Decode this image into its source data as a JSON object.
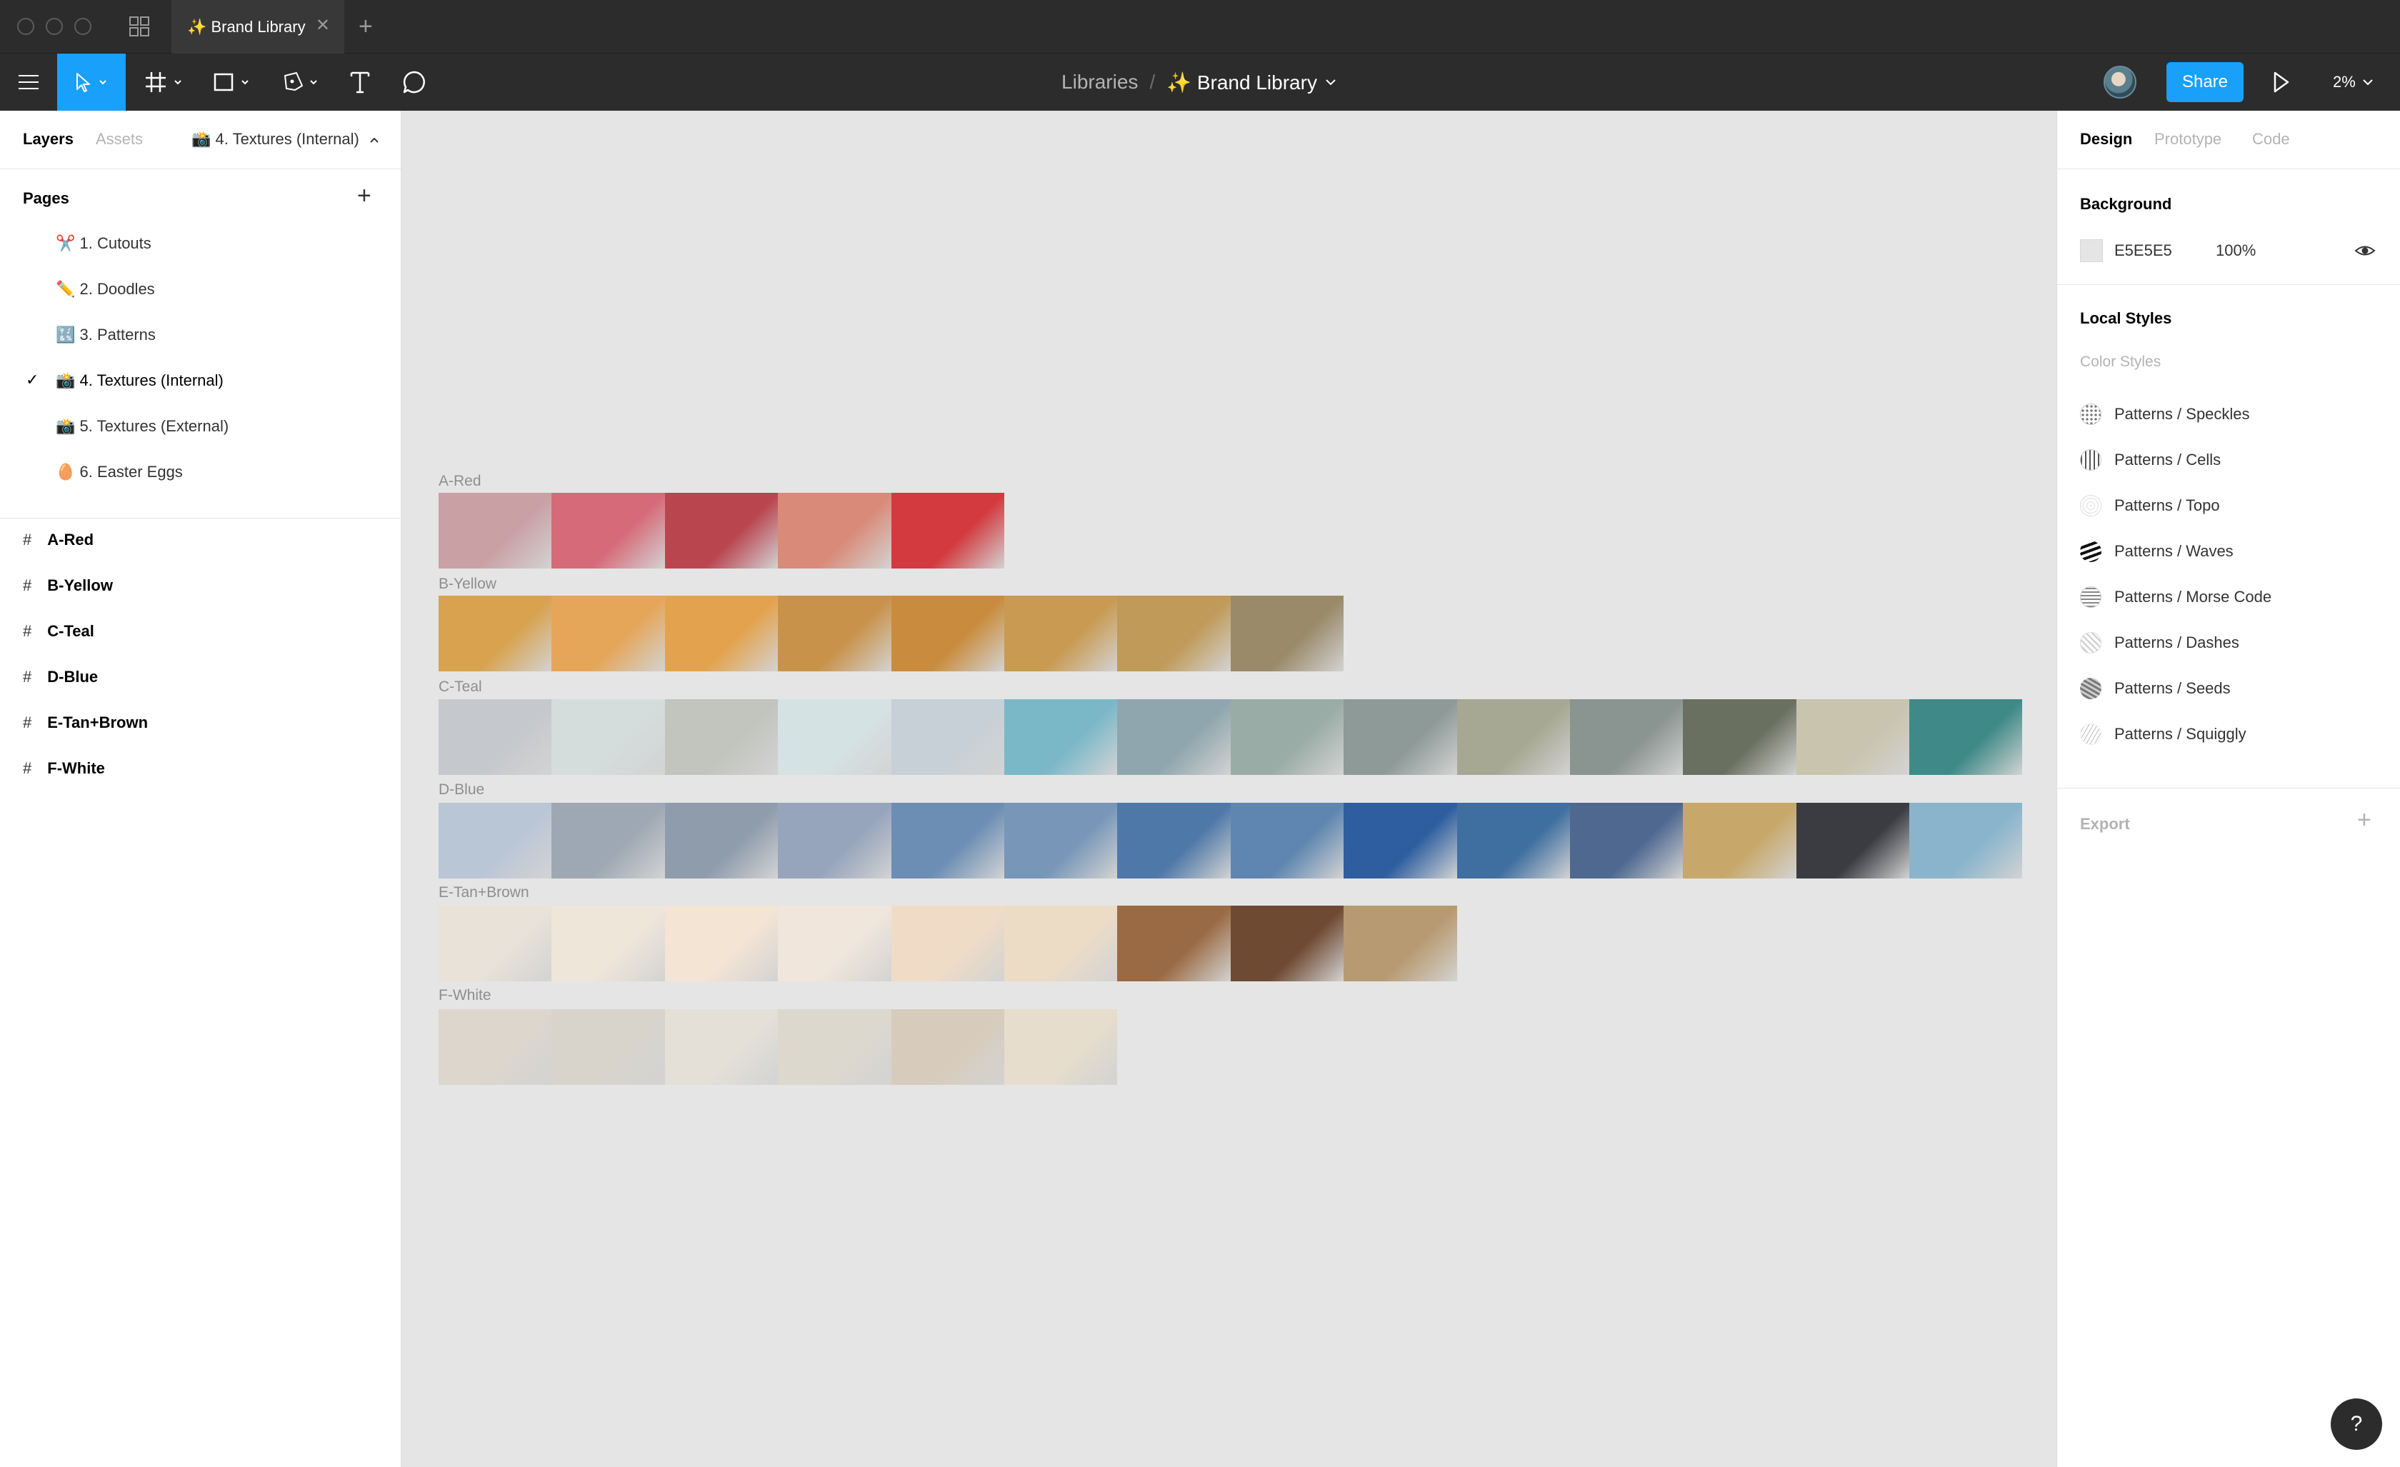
{
  "titlebar": {
    "tab_title": "✨ Brand Library",
    "tab_close": "✕",
    "new_tab": "+"
  },
  "toolbar": {
    "tools": [
      {
        "name": "move-tool",
        "icon": "cursor-icon"
      },
      {
        "name": "frame-tool",
        "icon": "hash-icon"
      },
      {
        "name": "shape-tool",
        "icon": "rectangle-icon"
      },
      {
        "name": "pen-tool",
        "icon": "pen-icon"
      },
      {
        "name": "text-tool",
        "icon": "text-icon"
      },
      {
        "name": "comment-tool",
        "icon": "comment-icon"
      }
    ],
    "breadcrumb_libraries": "Libraries",
    "breadcrumb_separator": "/",
    "file_name": "✨ Brand Library",
    "share_label": "Share",
    "zoom_label": "2%",
    "accent_color": "#18a0fb"
  },
  "left_panel": {
    "tab_layers": "Layers",
    "tab_assets": "Assets",
    "current_page": "📸 4. Textures (Internal)",
    "pages_title": "Pages",
    "pages_add": "+",
    "pages": [
      {
        "label": "✂️ 1. Cutouts",
        "selected": false
      },
      {
        "label": "✏️ 2. Doodles",
        "selected": false
      },
      {
        "label": "🔣 3. Patterns",
        "selected": false
      },
      {
        "label": "📸 4. Textures (Internal)",
        "selected": true
      },
      {
        "label": "📸 5. Textures (External)",
        "selected": false
      },
      {
        "label": "🥚 6. Easter Eggs",
        "selected": false
      }
    ],
    "check": "✓",
    "layers": [
      "A-Red",
      "B-Yellow",
      "C-Teal",
      "D-Blue",
      "E-Tan+Brown",
      "F-White"
    ],
    "hash": "#"
  },
  "right_panel": {
    "tab_design": "Design",
    "tab_prototype": "Prototype",
    "tab_code": "Code",
    "background_title": "Background",
    "background_hex": "E5E5E5",
    "background_opacity": "100%",
    "local_styles_title": "Local Styles",
    "color_styles_label": "Color Styles",
    "styles": [
      {
        "label": "Patterns / Speckles",
        "icon": "speckles-swatch"
      },
      {
        "label": "Patterns / Cells",
        "icon": "cells-swatch"
      },
      {
        "label": "Patterns / Topo",
        "icon": "topo-swatch"
      },
      {
        "label": "Patterns / Waves",
        "icon": "waves-swatch"
      },
      {
        "label": "Patterns / Morse Code",
        "icon": "morse-swatch"
      },
      {
        "label": "Patterns / Dashes",
        "icon": "dashes-swatch"
      },
      {
        "label": "Patterns / Seeds",
        "icon": "seeds-swatch"
      },
      {
        "label": "Patterns / Squiggly",
        "icon": "squiggly-swatch"
      }
    ],
    "export_title": "Export",
    "export_add": "+"
  },
  "help_label": "?",
  "canvas": {
    "background": "#e5e5e5",
    "frames": [
      {
        "label": "A-Red",
        "tiles": [
          "#c9a0a4",
          "#d66a78",
          "#b9454f",
          "#d98a78",
          "#d23a3f"
        ]
      },
      {
        "label": "B-Yellow",
        "tiles": [
          "#d8a24e",
          "#e5a65a",
          "#e3a34e",
          "#c9924a",
          "#c98c3e",
          "#c99a52",
          "#bf9a58",
          "#9a8a6a"
        ]
      },
      {
        "label": "C-Teal",
        "tiles": [
          "#c5c8cc",
          "#d4dcdc",
          "#c2c4be",
          "#d5e2e4",
          "#c6d0d6",
          "#7ab8c8",
          "#8fa6ae",
          "#9aaca6",
          "#8e9a98",
          "#a7a894",
          "#8a9490",
          "#6a7060",
          "#c9c4ae",
          "#3f8a88"
        ]
      },
      {
        "label": "D-Blue",
        "tiles": [
          "#b9c6d6",
          "#9ea8b4",
          "#8e9cac",
          "#96a4bc",
          "#6d8eb4",
          "#7796b8",
          "#4e78a8",
          "#5f86b0",
          "#2e5ea0",
          "#3f6ea0",
          "#4e6890",
          "#c7a86a",
          "#3a3c42",
          "#8ab4cc"
        ]
      },
      {
        "label": "E-Tan+Brown",
        "tiles": [
          "#e8e2d8",
          "#efe6da",
          "#f4e4d4",
          "#f0e6dc",
          "#f0dcc6",
          "#ecdcc6",
          "#9a6a44",
          "#6e4a32",
          "#b89a72"
        ]
      },
      {
        "label": "F-White",
        "tiles": [
          "#dcd6cc",
          "#d8d4cc",
          "#e4e0d8",
          "#ddd8ce",
          "#d7ccbc",
          "#e6ddcc"
        ]
      }
    ]
  }
}
